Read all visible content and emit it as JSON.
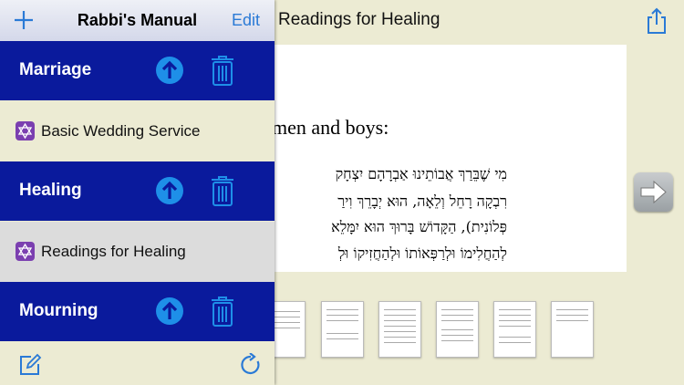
{
  "header": {
    "title": "Rabbi's Manual",
    "edit_label": "Edit",
    "add_icon": "plus-icon"
  },
  "document": {
    "title": "Readings for Healing",
    "heading": "men and boys:",
    "hebrew_lines": [
      "מִי שֶׁבֵּרַךְ אֲבוֹתֵינוּ אַבְרָהָם יִצְחָק",
      "רִבְקָה רָחֵל וְלֵאָה, הוּא יְבָרֵךְ וִירַ",
      "פְּלוֹנִית), הַקָּדוֹשׁ בָּרוּךְ הוּא יִמָּלֵא",
      "לְהַחֲלִימוֹ וּלְרַפְּאוֹתוֹ וּלְהַחֲזִיקוֹ וּלְ"
    ],
    "share_icon": "share-icon",
    "next_icon": "right-arrow-icon"
  },
  "sections": [
    {
      "label": "Marriage"
    },
    {
      "label": "Healing"
    },
    {
      "label": "Mourning"
    }
  ],
  "items": [
    {
      "label": "Basic Wedding Service",
      "icon": "star-of-david-icon",
      "selected": false
    },
    {
      "label": "Readings for Healing",
      "icon": "star-of-david-icon",
      "selected": true
    }
  ],
  "toolbar": {
    "compose_icon": "compose-icon",
    "refresh_icon": "refresh-icon"
  },
  "colors": {
    "section_bg": "#0a1a9c",
    "panel_bg": "#ecebd3",
    "selected_bg": "#dcdcdc",
    "accent": "#2a7ad6",
    "item_icon_bg": "#7b3fb0"
  }
}
